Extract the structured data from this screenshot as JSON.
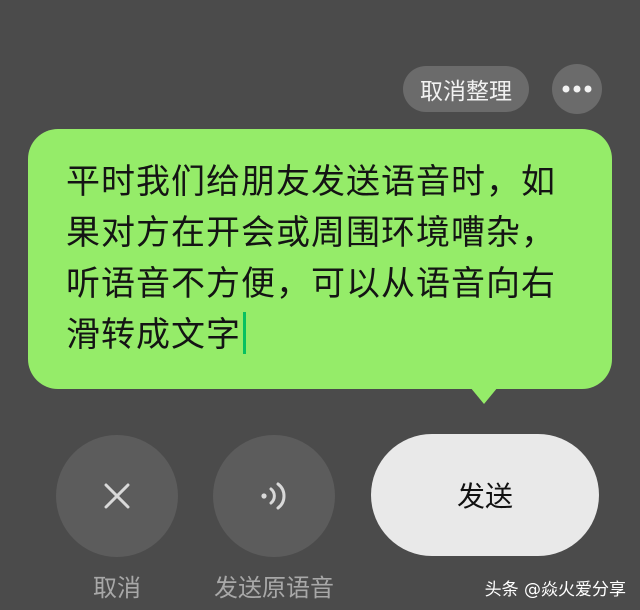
{
  "top_actions": {
    "cancel_organize_label": "取消整理",
    "more_icon": "more-dots-icon"
  },
  "bubble": {
    "text": "平时我们给朋友发送语音时，如果对方在开会或周围环境嘈杂，听语音不方便，可以从语音向右滑转成文字",
    "background_color": "#95ec69",
    "cursor_color": "#07c160"
  },
  "bottom_actions": {
    "cancel_label": "取消",
    "cancel_icon": "close-icon",
    "send_voice_label": "发送原语音",
    "send_voice_icon": "voice-wave-icon",
    "send_label": "发送"
  },
  "watermark": {
    "text": "头条 @焱火爱分享"
  }
}
